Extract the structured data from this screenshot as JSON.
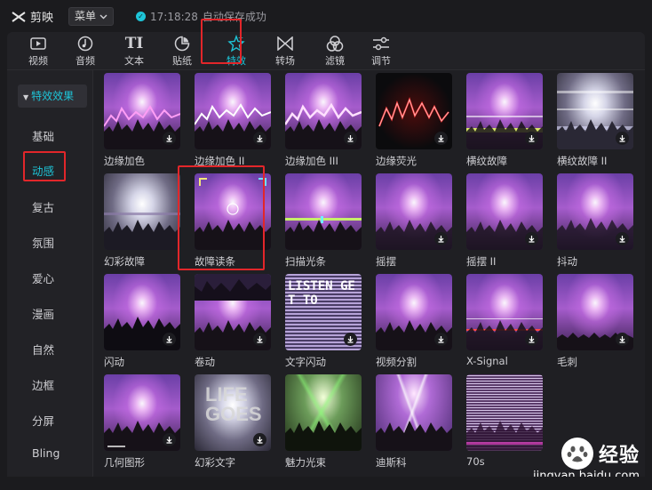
{
  "app": {
    "name": "剪映",
    "menu_label": "菜单"
  },
  "status": {
    "time": "17:18:28",
    "message": "自动保存成功"
  },
  "toolbar": {
    "items": [
      {
        "label": "视频",
        "icon": "video-icon"
      },
      {
        "label": "音频",
        "icon": "audio-icon"
      },
      {
        "label": "文本",
        "icon": "text-icon"
      },
      {
        "label": "贴纸",
        "icon": "sticker-icon"
      },
      {
        "label": "特效",
        "icon": "effects-star-icon",
        "active": true
      },
      {
        "label": "转场",
        "icon": "transition-icon"
      },
      {
        "label": "滤镜",
        "icon": "filter-icon"
      },
      {
        "label": "调节",
        "icon": "adjust-icon"
      }
    ],
    "text_icon_glyph": "TI"
  },
  "sidebar": {
    "header": "特效效果",
    "categories": [
      "基础",
      "动感",
      "复古",
      "氛围",
      "爱心",
      "漫画",
      "自然",
      "边框",
      "分屏",
      "Bling"
    ],
    "active": "动感"
  },
  "effects": [
    {
      "label": "边缘加色"
    },
    {
      "label": "边缘加色 II"
    },
    {
      "label": "边缘加色 III"
    },
    {
      "label": "边缘荧光"
    },
    {
      "label": "横纹故障"
    },
    {
      "label": "横纹故障 II"
    },
    {
      "label": "幻彩故障"
    },
    {
      "label": "故障读条"
    },
    {
      "label": "扫描光条"
    },
    {
      "label": "摇摆"
    },
    {
      "label": "摇摆 II"
    },
    {
      "label": "抖动"
    },
    {
      "label": "闪动"
    },
    {
      "label": "卷动"
    },
    {
      "label": "文字闪动"
    },
    {
      "label": "视频分割"
    },
    {
      "label": "X-Signal"
    },
    {
      "label": "毛刺"
    },
    {
      "label": "几何图形"
    },
    {
      "label": "幻彩文字"
    },
    {
      "label": "魅力光束"
    },
    {
      "label": "迪斯科"
    },
    {
      "label": "70s"
    }
  ],
  "thumb_text": {
    "text_flash": "LISTEN GET TO",
    "colorful_text": "LIFE GOES"
  },
  "watermark": {
    "brand": "经验",
    "url": "jingyan.baidu.com"
  },
  "colors": {
    "accent": "#1ec5d8",
    "highlight_box": "#e2262a",
    "background": "#1b1b1e"
  }
}
